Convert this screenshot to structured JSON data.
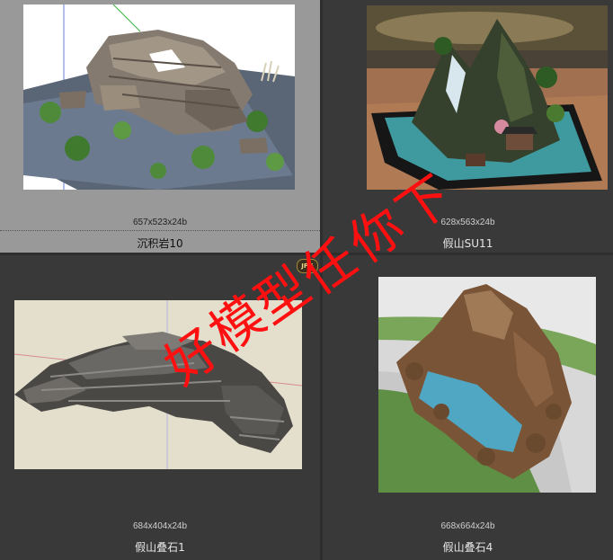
{
  "items": [
    {
      "dims": "657x523x24b",
      "name": "沉积岩10",
      "selected": true
    },
    {
      "dims": "628x563x24b",
      "name": "假山SU11",
      "selected": false
    },
    {
      "dims": "684x404x24b",
      "name": "假山叠石1",
      "selected": false
    },
    {
      "dims": "668x664x24b",
      "name": "假山叠石4",
      "selected": false
    }
  ],
  "badge": {
    "label": "JPG"
  },
  "watermark": {
    "chars": [
      "好",
      "模",
      "型",
      "任",
      "你",
      "下"
    ],
    "color": "#ff1010"
  },
  "colors": {
    "background": "#2e2e2e",
    "cell": "#393939",
    "selected_cell": "#999999"
  }
}
